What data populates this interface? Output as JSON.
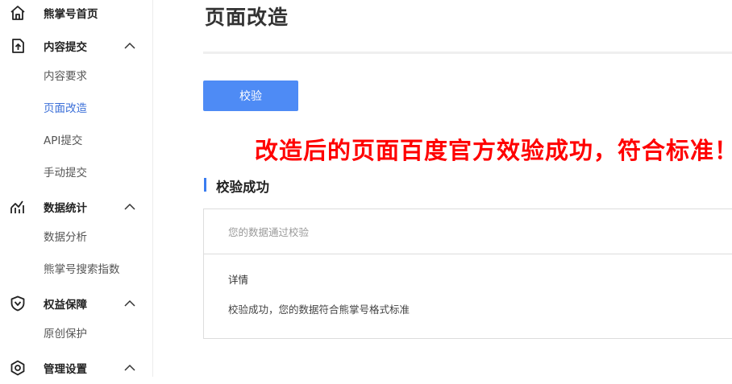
{
  "sidebar": {
    "home": {
      "label": "熊掌号首页",
      "icon": "home-icon"
    },
    "content_submit": {
      "label": "内容提交",
      "icon": "upload-file-icon",
      "items": [
        "内容要求",
        "页面改造",
        "API提交",
        "手动提交"
      ],
      "active_item": "页面改造"
    },
    "data_stats": {
      "label": "数据统计",
      "icon": "chart-icon",
      "items": [
        "数据分析",
        "熊掌号搜索指数"
      ]
    },
    "rights": {
      "label": "权益保障",
      "icon": "shield-icon",
      "items": [
        "原创保护"
      ]
    },
    "settings": {
      "label": "管理设置",
      "icon": "settings-icon"
    }
  },
  "main": {
    "page_title": "页面改造",
    "verify_button": "校验",
    "annotation": "改造后的页面百度官方效验成功，符合标准！",
    "result": {
      "section_title": "校验成功",
      "summary": "您的数据通过校验",
      "detail_label": "详情",
      "detail_text": "校验成功，您的数据符合熊掌号格式标准"
    }
  },
  "colors": {
    "accent": "#4e8bf5",
    "active_link": "#3b6fd8",
    "annotation": "#ff0000"
  }
}
